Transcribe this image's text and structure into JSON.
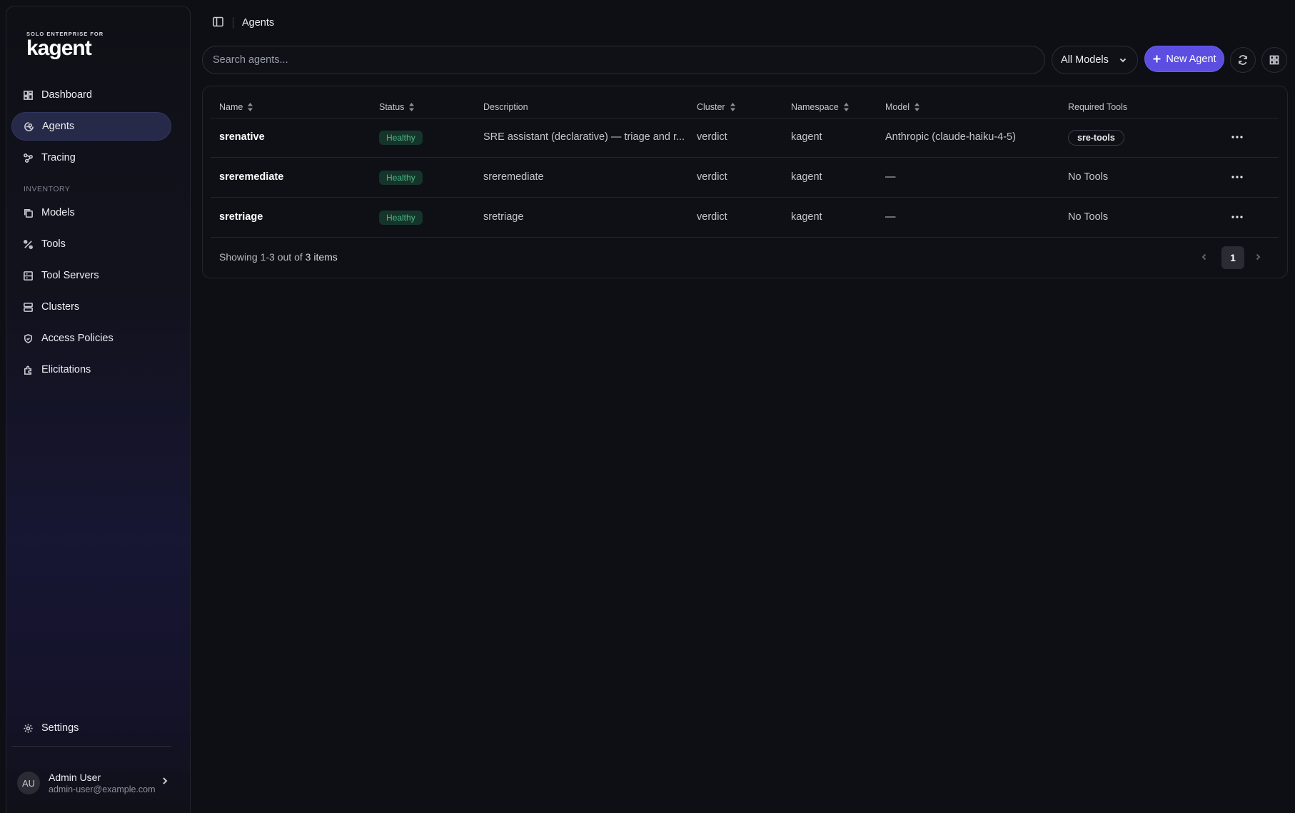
{
  "brand": {
    "small": "SOLO ENTERPRISE FOR",
    "name": "kagent"
  },
  "sidebar": {
    "items": [
      {
        "label": "Dashboard",
        "icon": "dashboard-icon"
      },
      {
        "label": "Agents",
        "icon": "agents-icon",
        "active": true
      },
      {
        "label": "Tracing",
        "icon": "tracing-icon"
      }
    ],
    "inventory_label": "INVENTORY",
    "inventory": [
      {
        "label": "Models",
        "icon": "models-icon"
      },
      {
        "label": "Tools",
        "icon": "tools-icon"
      },
      {
        "label": "Tool Servers",
        "icon": "tool-servers-icon"
      },
      {
        "label": "Clusters",
        "icon": "clusters-icon"
      },
      {
        "label": "Access Policies",
        "icon": "shield-icon"
      },
      {
        "label": "Elicitations",
        "icon": "puzzle-icon"
      }
    ],
    "settings": {
      "label": "Settings",
      "icon": "gear-icon"
    },
    "user": {
      "initials": "AU",
      "name": "Admin User",
      "email": "admin-user@example.com"
    }
  },
  "header": {
    "breadcrumb": "Agents"
  },
  "toolbar": {
    "search_placeholder": "Search agents...",
    "model_filter": "All Models",
    "new_agent_label": "New Agent"
  },
  "table": {
    "columns": {
      "name": "Name",
      "status": "Status",
      "description": "Description",
      "cluster": "Cluster",
      "namespace": "Namespace",
      "model": "Model",
      "required_tools": "Required Tools"
    },
    "rows": [
      {
        "name": "srenative",
        "status": "Healthy",
        "description": "SRE assistant (declarative) — triage and r...",
        "cluster": "verdict",
        "namespace": "kagent",
        "model": "Anthropic (claude-haiku-4-5)",
        "tools": "sre-tools"
      },
      {
        "name": "sreremediate",
        "status": "Healthy",
        "description": "sreremediate",
        "cluster": "verdict",
        "namespace": "kagent",
        "model": "—",
        "tools": "No Tools"
      },
      {
        "name": "sretriage",
        "status": "Healthy",
        "description": "sretriage",
        "cluster": "verdict",
        "namespace": "kagent",
        "model": "—",
        "tools": "No Tools"
      }
    ],
    "footer": {
      "prefix": "Showing 1-3 out of ",
      "count": "3",
      "suffix": " items"
    },
    "pagination": {
      "current": "1"
    }
  },
  "colors": {
    "accent": "#5b4ee0",
    "healthy": "#4bb98a",
    "background": "#0d0f15"
  }
}
